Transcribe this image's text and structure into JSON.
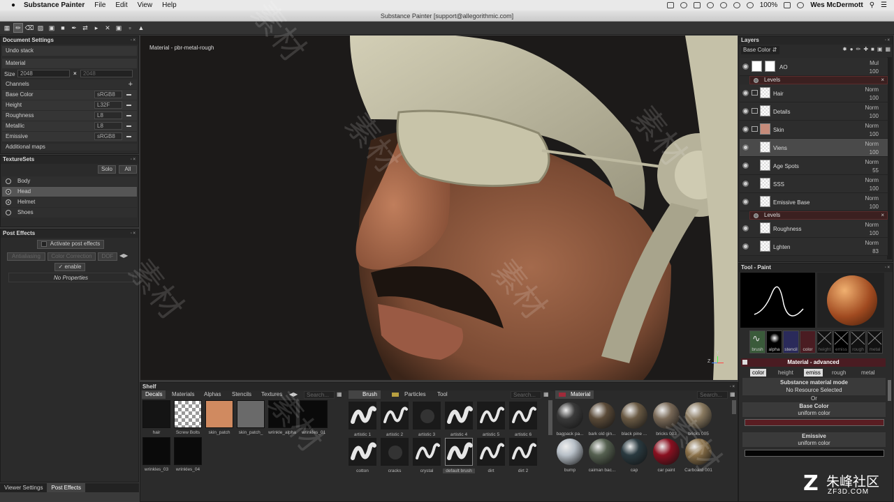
{
  "menubar": {
    "app": "Substance Painter",
    "items": [
      "File",
      "Edit",
      "View",
      "Help"
    ],
    "battery": "100%",
    "user": "Wes McDermott"
  },
  "window": {
    "title": "Substance Painter [support@allegorithmic.com]"
  },
  "viewport": {
    "label": "Material - pbr-metal-rough",
    "axis_y": "Y",
    "axis_z": "Z"
  },
  "document_settings": {
    "title": "Document Settings",
    "undo": "Undo stack",
    "material": "Material",
    "size_label": "Size",
    "size_w": "2048",
    "size_h": "2048",
    "channels_label": "Channels",
    "channels": [
      {
        "name": "Base Color",
        "fmt": "sRGB8"
      },
      {
        "name": "Height",
        "fmt": "L32F"
      },
      {
        "name": "Roughness",
        "fmt": "L8"
      },
      {
        "name": "Metallic",
        "fmt": "L8"
      },
      {
        "name": "Emissive",
        "fmt": "sRGB8"
      }
    ],
    "additional": "Additional maps"
  },
  "texturesets": {
    "title": "TextureSets",
    "solo": "Solo",
    "all": "All",
    "items": [
      "Body",
      "Head",
      "Helmet",
      "Shoes"
    ]
  },
  "post_effects": {
    "title": "Post Effects",
    "activate": "Activate post effects",
    "tabs": [
      "Antialiasing",
      "Color Correction",
      "DOF"
    ],
    "enable": "enable",
    "none": "No Properties"
  },
  "bottom_tabs": [
    "Viewer Settings",
    "Post Effects"
  ],
  "layers": {
    "title": "Layers",
    "channel": "Base Color",
    "items": [
      {
        "name": "AO",
        "blend": "Mul",
        "opacity": "100"
      },
      {
        "name": "Hair",
        "blend": "Norm",
        "opacity": "100"
      },
      {
        "name": "Details",
        "blend": "Norm",
        "opacity": "100"
      },
      {
        "name": "Skin",
        "blend": "Norm",
        "opacity": "100"
      },
      {
        "name": "Viens",
        "blend": "Norm",
        "opacity": "100"
      },
      {
        "name": "Age Spots",
        "blend": "Norm",
        "opacity": "55"
      },
      {
        "name": "SSS",
        "blend": "Norm",
        "opacity": "100"
      },
      {
        "name": "Emissive Base",
        "blend": "Norm",
        "opacity": "100"
      },
      {
        "name": "Roughness",
        "blend": "Norm",
        "opacity": "100"
      },
      {
        "name": "Lghten",
        "blend": "Norm",
        "opacity": "83"
      }
    ],
    "levels": "Levels"
  },
  "tool": {
    "title": "Tool - Paint",
    "channels": [
      "brush",
      "alpha",
      "stencil",
      "color",
      "height",
      "emiss",
      "rough",
      "metal"
    ],
    "material_header": "Material - advanced",
    "mat_tabs": [
      "color",
      "height",
      "emiss",
      "rough",
      "metal"
    ],
    "mode_title": "Substance material mode",
    "mode_value": "No Resource Selected",
    "or": "Or",
    "base_title": "Base Color",
    "base_value": "uniform color",
    "emissive_title": "Emissive",
    "emissive_value": "uniform color",
    "base_swatch": "#5a1d22",
    "emissive_swatch": "#050505"
  },
  "shelf": {
    "title": "Shelf",
    "tabs": [
      "Decals",
      "Materials",
      "Alphas",
      "Stencils",
      "Textures"
    ],
    "search": "Search...",
    "decals": [
      "hair",
      "Screw Bolts",
      "skin_patch",
      "skin_patch_",
      "wrinkle_alpha",
      "wrinkles_01",
      "wrinkles_03",
      "wrinkles_04"
    ],
    "brush_tabs": [
      "Brush",
      "Particles",
      "Tool"
    ],
    "brushes": [
      "artistic 1",
      "artistic 2",
      "artistic 3",
      "artistic 4",
      "artistic 5",
      "artistic 6",
      "cotton",
      "cracks",
      "crystal",
      "default brush",
      "dirt",
      "dirt 2"
    ],
    "material_tab": "Material",
    "materials": [
      "bagpack pa...",
      "bark old gin...",
      "black pine ...",
      "bricks 003",
      "bricks 005",
      "bump",
      "caiman bac...",
      "cap",
      "car paint",
      "Carboard 001"
    ]
  },
  "watermark": {
    "text": "素材",
    "brand": "朱峰社区",
    "url": "ZF3D.COM"
  }
}
